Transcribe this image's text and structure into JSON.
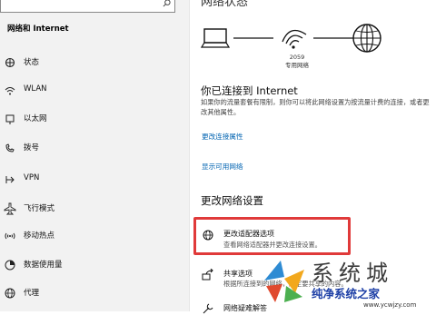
{
  "sidebar": {
    "title": "网络和 Internet",
    "items": [
      {
        "label": "状态",
        "icon": "home-icon"
      },
      {
        "label": "WLAN",
        "icon": "wifi-icon"
      },
      {
        "label": "以太网",
        "icon": "ethernet-icon"
      },
      {
        "label": "拨号",
        "icon": "dialup-icon"
      },
      {
        "label": "VPN",
        "icon": "vpn-icon"
      },
      {
        "label": "飞行模式",
        "icon": "airplane-icon"
      },
      {
        "label": "移动热点",
        "icon": "hotspot-icon"
      },
      {
        "label": "数据使用量",
        "icon": "data-usage-icon"
      },
      {
        "label": "代理",
        "icon": "globe-icon"
      }
    ]
  },
  "main": {
    "status_title": "网络状态",
    "network_name": "2059",
    "network_type": "专用网络",
    "connected_heading": "你已连接到 Internet",
    "connected_desc": "如果你的流量套餐有限制，则你可以将此网络设置为按流量计费的连接，或者更改其他属性。",
    "link_change_properties": "更改连接属性",
    "link_show_networks": "显示可用网络",
    "section_title": "更改网络设置",
    "options": [
      {
        "title": "更改适配器选项",
        "desc": "查看网络适配器并更改连接设置。",
        "icon": "adapter-icon"
      },
      {
        "title": "共享选项",
        "desc": "根据所连接到的网络，决定要共享的内容。",
        "icon": "share-icon"
      },
      {
        "title": "网络疑难解答",
        "desc": "",
        "icon": "troubleshoot-icon"
      }
    ]
  },
  "watermark": {
    "big_text": "系统城",
    "small_text": "纯净系统之家",
    "url": "www.ycwjzy.com"
  },
  "colors": {
    "link": "#0063b1",
    "highlight_box": "#e03a3a",
    "sidebar_bg": "#f2f2f2"
  }
}
